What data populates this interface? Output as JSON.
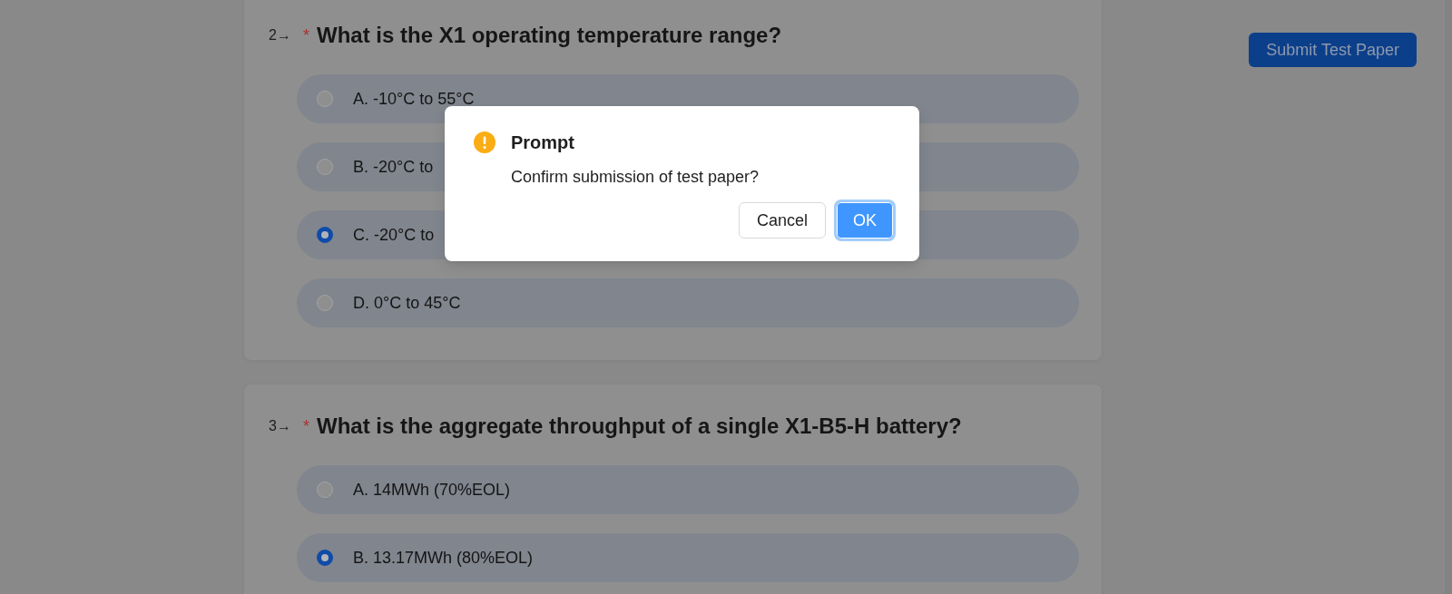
{
  "submit_button": {
    "label": "Submit Test Paper"
  },
  "questions": [
    {
      "number": "2→",
      "required_mark": "*",
      "title": "What is the X1 operating temperature range?",
      "options": [
        {
          "label": "A. -10°C to 55°C",
          "selected": false
        },
        {
          "label": "B. -20°C to",
          "selected": false
        },
        {
          "label": "C. -20°C to",
          "selected": true
        },
        {
          "label": "D. 0°C to 45°C",
          "selected": false
        }
      ]
    },
    {
      "number": "3→",
      "required_mark": "*",
      "title": "What is the aggregate throughput of a single X1-B5-H battery?",
      "options": [
        {
          "label": "A. 14MWh (70%EOL)",
          "selected": false
        },
        {
          "label": "B. 13.17MWh (80%EOL)",
          "selected": true
        }
      ]
    }
  ],
  "dialog": {
    "title": "Prompt",
    "message": "Confirm submission of test paper?",
    "buttons": [
      {
        "label": "Cancel",
        "kind": "default",
        "focused": false
      },
      {
        "label": "OK",
        "kind": "primary",
        "focused": true
      }
    ]
  }
}
